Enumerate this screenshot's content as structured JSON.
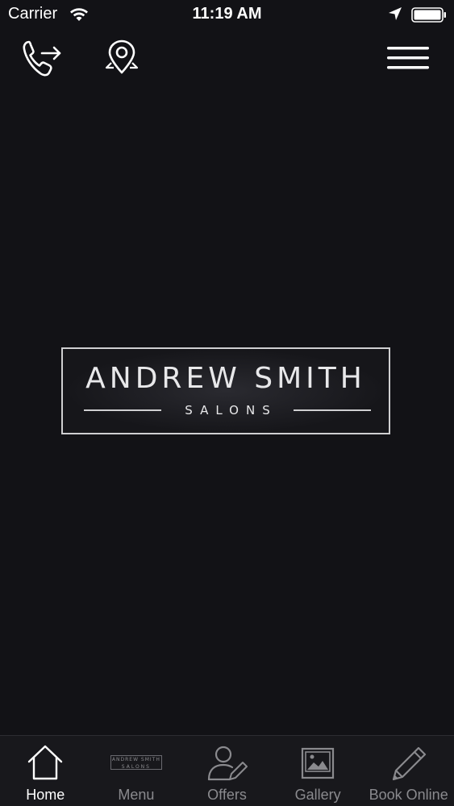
{
  "status_bar": {
    "carrier": "Carrier",
    "time": "11:19 AM"
  },
  "toolbar": {
    "call_icon": "phone-forward-icon",
    "map_icon": "map-pin-icon",
    "menu_icon": "hamburger-menu-icon"
  },
  "logo": {
    "title": "ANDREW SMITH",
    "subtitle": "SALONS"
  },
  "tabs": [
    {
      "label": "Home",
      "icon": "house-icon",
      "active": true
    },
    {
      "label": "Menu",
      "icon": "mini-logo-icon",
      "active": false
    },
    {
      "label": "Offers",
      "icon": "person-pencil-icon",
      "active": false
    },
    {
      "label": "Gallery",
      "icon": "picture-icon",
      "active": false
    },
    {
      "label": "Book Online",
      "icon": "pencil-icon",
      "active": false
    }
  ],
  "menu_tab_logo": {
    "title": "ANDREW SMITH",
    "subtitle": "SALONS"
  },
  "colors": {
    "background": "#121216",
    "tab_bar": "#18181c",
    "active_label": "#ffffff",
    "inactive_label": "#8a8a8e"
  }
}
